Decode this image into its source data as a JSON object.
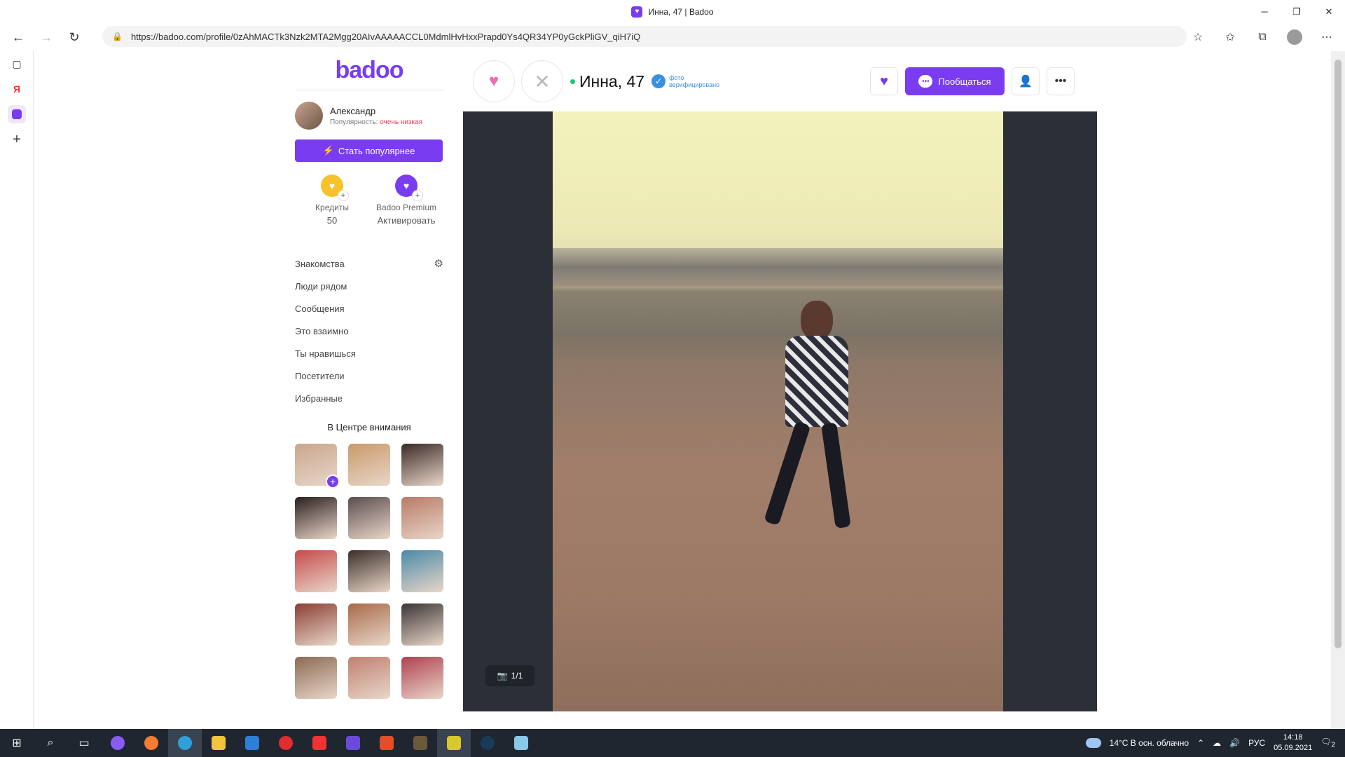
{
  "browser": {
    "tab_title": "Инна, 47 | Badoo",
    "url": "https://badoo.com/profile/0zAhMACTk3Nzk2MTA2Mgg20AIvAAAAACCL0MdmlHvHxxPrapd0Ys4QR34YP0yGckPliGV_qiH7iQ"
  },
  "sidebar": {
    "logo": "badoo",
    "user": {
      "name": "Александр",
      "popularity_label": "Популярность:",
      "popularity_value": "очень низкая"
    },
    "boost_button": "Стать популярнее",
    "credits": {
      "label": "Кредиты",
      "value": "50"
    },
    "premium": {
      "label": "Badoo Premium",
      "value": "Активировать"
    },
    "menu": [
      "Знакомства",
      "Люди рядом",
      "Сообщения",
      "Это взаимно",
      "Ты нравишься",
      "Посетители",
      "Избранные"
    ],
    "spotlight_title": "В Центре внимания",
    "spotlight_colors": [
      "#c9a68d",
      "#c99a6a",
      "#3a2a25",
      "#2a1f1e",
      "#5a4d4d",
      "#b87a66",
      "#c64a4a",
      "#3a2f28",
      "#4a8aa8",
      "#8a3e33",
      "#a86a4a",
      "#3b3535",
      "#8a6a54",
      "#c08070",
      "#b04050"
    ]
  },
  "profile": {
    "name": "Инна, 47",
    "verified_text_1": "фото",
    "verified_text_2": "верифицировано",
    "chat_button": "Пообщаться",
    "photo_counter": "1/1"
  },
  "taskbar": {
    "weather": "14°C  В осн. облачно",
    "lang": "РУС",
    "time": "14:18",
    "date": "05.09.2021",
    "notif_count": "2"
  }
}
